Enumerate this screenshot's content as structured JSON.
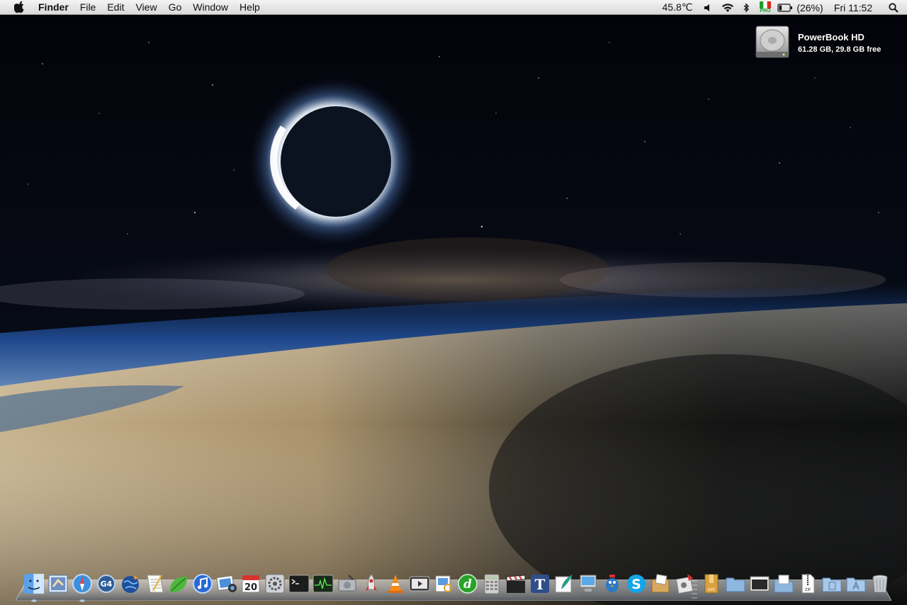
{
  "menubar": {
    "app_name": "Finder",
    "menus": [
      "File",
      "Edit",
      "View",
      "Go",
      "Window",
      "Help"
    ],
    "status": {
      "temperature": "45.8℃",
      "battery_percent": "(26%)",
      "battery_level": 0.26,
      "input_badge": "PRO",
      "clock": "Fri 11:52"
    }
  },
  "desktop": {
    "drive_name": "PowerBook HD",
    "drive_info": "61.28 GB, 29.8 GB free"
  },
  "dock": {
    "apps": [
      {
        "name": "finder-icon",
        "running": true
      },
      {
        "name": "mail-icon",
        "running": false
      },
      {
        "name": "safari-icon",
        "running": true
      },
      {
        "name": "g4-icon",
        "running": false
      },
      {
        "name": "camino-globe-icon",
        "running": false
      },
      {
        "name": "textedit-icon",
        "running": false
      },
      {
        "name": "leaf-icon",
        "running": false
      },
      {
        "name": "itunes-icon",
        "running": false
      },
      {
        "name": "iphoto-icon",
        "running": false
      },
      {
        "name": "ical-icon",
        "running": false,
        "label": "20"
      },
      {
        "name": "system-preferences-icon",
        "running": false
      },
      {
        "name": "terminal-icon",
        "running": false
      },
      {
        "name": "activity-monitor-icon",
        "running": false
      },
      {
        "name": "disk-utility-icon",
        "running": false
      },
      {
        "name": "rocket-icon",
        "running": false
      },
      {
        "name": "vlc-icon",
        "running": false
      },
      {
        "name": "front-row-icon",
        "running": false
      },
      {
        "name": "preview-icon",
        "running": false
      },
      {
        "name": "dreamweaver-icon",
        "running": false
      },
      {
        "name": "calculator-icon",
        "running": false
      },
      {
        "name": "clapboard-icon",
        "running": false
      },
      {
        "name": "typography-icon",
        "running": false
      },
      {
        "name": "quill-icon",
        "running": false
      },
      {
        "name": "monitor-icon",
        "running": false
      },
      {
        "name": "adium-bird-icon",
        "running": false
      },
      {
        "name": "skype-icon",
        "running": false
      },
      {
        "name": "package-icon",
        "running": false
      },
      {
        "name": "stamp-icon",
        "running": false
      }
    ],
    "stacks": [
      {
        "name": "exe-archive-icon"
      },
      {
        "name": "folder-icon"
      },
      {
        "name": "screenshot-folder-icon"
      },
      {
        "name": "documents-folder-icon"
      },
      {
        "name": "zip-file-icon"
      },
      {
        "name": "downloads-folder-icon"
      },
      {
        "name": "applications-folder-icon"
      },
      {
        "name": "trash-icon"
      }
    ]
  },
  "colors": {
    "menubar": "#e6e6e6",
    "label": "#ffffff",
    "flag_green": "#1a9e2a",
    "flag_red": "#d52b1e"
  }
}
